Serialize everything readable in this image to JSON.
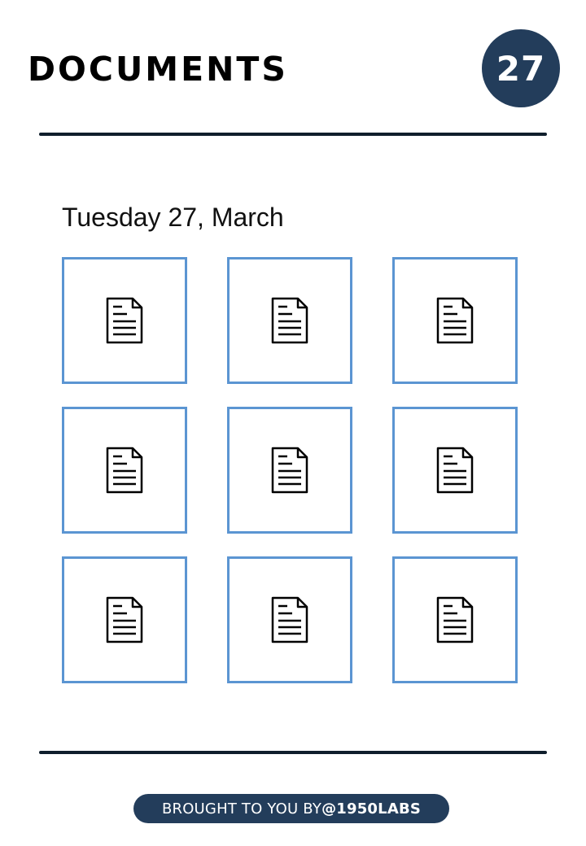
{
  "header": {
    "title": "DOCUMENTS",
    "day_badge": "27"
  },
  "date_label": "Tuesday 27, March",
  "documents": [
    {
      "icon": "document-icon"
    },
    {
      "icon": "document-icon"
    },
    {
      "icon": "document-icon"
    },
    {
      "icon": "document-icon"
    },
    {
      "icon": "document-icon"
    },
    {
      "icon": "document-icon"
    },
    {
      "icon": "document-icon"
    },
    {
      "icon": "document-icon"
    },
    {
      "icon": "document-icon"
    }
  ],
  "footer": {
    "prefix": "BROUGHT TO YOU BY ",
    "brand": "@1950LABS"
  },
  "colors": {
    "accent": "#233d5b",
    "tile_border": "#5b95d2",
    "rule": "#0f1e2c"
  }
}
